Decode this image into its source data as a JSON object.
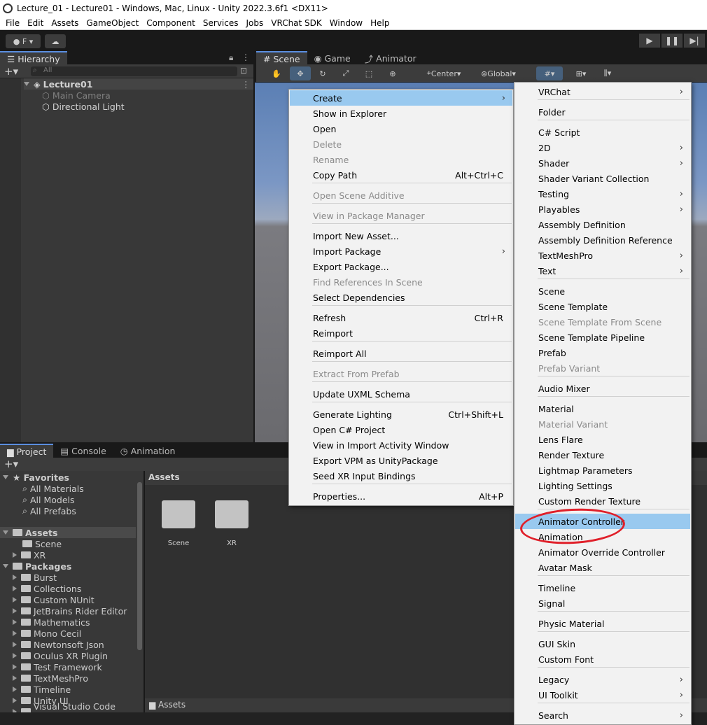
{
  "window": {
    "title": "Lecture_01 - Lecture01 - Windows, Mac, Linux - Unity 2022.3.6f1 <DX11>"
  },
  "menubar": [
    "File",
    "Edit",
    "Assets",
    "GameObject",
    "Component",
    "Services",
    "Jobs",
    "VRChat SDK",
    "Window",
    "Help"
  ],
  "toolbar": {
    "account_label": "F"
  },
  "hierarchy": {
    "tab": "Hierarchy",
    "search_placeholder": "All",
    "scene": "Lecture01",
    "items": [
      "Main Camera",
      "Directional Light"
    ]
  },
  "scene_tabs": [
    "Scene",
    "Game",
    "Animator"
  ],
  "scene_toolbar": {
    "pivot": "Center",
    "space": "Global"
  },
  "bottom_tabs": [
    "Project",
    "Console",
    "Animation"
  ],
  "project": {
    "favorites_label": "Favorites",
    "favorites": [
      "All Materials",
      "All Models",
      "All Prefabs"
    ],
    "assets_label": "Assets",
    "assets_children": [
      "Scene",
      "XR"
    ],
    "packages_label": "Packages",
    "packages": [
      "Burst",
      "Collections",
      "Custom NUnit",
      "JetBrains Rider Editor",
      "Mathematics",
      "Mono Cecil",
      "Newtonsoft Json",
      "Oculus XR Plugin",
      "Test Framework",
      "TextMeshPro",
      "Timeline",
      "Unity UI",
      "Visual Studio Code Editor"
    ],
    "breadcrumb": "Assets",
    "grid_items": [
      "Scene",
      "XR"
    ],
    "footer_path": "Assets"
  },
  "context_menu": {
    "items": [
      {
        "label": "Create",
        "shortcut": "",
        "submenu": true,
        "disabled": false,
        "highlight": true
      },
      {
        "label": "Show in Explorer",
        "shortcut": "",
        "submenu": false,
        "disabled": false
      },
      {
        "label": "Open",
        "shortcut": "",
        "submenu": false,
        "disabled": false
      },
      {
        "label": "Delete",
        "shortcut": "",
        "submenu": false,
        "disabled": true
      },
      {
        "label": "Rename",
        "shortcut": "",
        "submenu": false,
        "disabled": true
      },
      {
        "label": "Copy Path",
        "shortcut": "Alt+Ctrl+C",
        "submenu": false,
        "disabled": false
      },
      {
        "label": "Open Scene Additive",
        "shortcut": "",
        "submenu": false,
        "disabled": true
      },
      {
        "label": "View in Package Manager",
        "shortcut": "",
        "submenu": false,
        "disabled": true
      },
      {
        "label": "Import New Asset...",
        "shortcut": "",
        "submenu": false,
        "disabled": false
      },
      {
        "label": "Import Package",
        "shortcut": "",
        "submenu": true,
        "disabled": false
      },
      {
        "label": "Export Package...",
        "shortcut": "",
        "submenu": false,
        "disabled": false
      },
      {
        "label": "Find References In Scene",
        "shortcut": "",
        "submenu": false,
        "disabled": true
      },
      {
        "label": "Select Dependencies",
        "shortcut": "",
        "submenu": false,
        "disabled": false
      },
      {
        "label": "Refresh",
        "shortcut": "Ctrl+R",
        "submenu": false,
        "disabled": false
      },
      {
        "label": "Reimport",
        "shortcut": "",
        "submenu": false,
        "disabled": false
      },
      {
        "label": "Reimport All",
        "shortcut": "",
        "submenu": false,
        "disabled": false
      },
      {
        "label": "Extract From Prefab",
        "shortcut": "",
        "submenu": false,
        "disabled": true
      },
      {
        "label": "Update UXML Schema",
        "shortcut": "",
        "submenu": false,
        "disabled": false
      },
      {
        "label": "Generate Lighting",
        "shortcut": "Ctrl+Shift+L",
        "submenu": false,
        "disabled": false
      },
      {
        "label": "Open C# Project",
        "shortcut": "",
        "submenu": false,
        "disabled": false
      },
      {
        "label": "View in Import Activity Window",
        "shortcut": "",
        "submenu": false,
        "disabled": false
      },
      {
        "label": "Export VPM as UnityPackage",
        "shortcut": "",
        "submenu": false,
        "disabled": false
      },
      {
        "label": "Seed XR Input Bindings",
        "shortcut": "",
        "submenu": false,
        "disabled": false
      },
      {
        "label": "Properties...",
        "shortcut": "Alt+P",
        "submenu": false,
        "disabled": false
      }
    ]
  },
  "create_menu": {
    "items": [
      {
        "label": "VRChat",
        "submenu": true,
        "disabled": false
      },
      {
        "label": "Folder",
        "submenu": false,
        "disabled": false
      },
      {
        "label": "C# Script",
        "submenu": false,
        "disabled": false
      },
      {
        "label": "2D",
        "submenu": true,
        "disabled": false
      },
      {
        "label": "Shader",
        "submenu": true,
        "disabled": false
      },
      {
        "label": "Shader Variant Collection",
        "submenu": false,
        "disabled": false
      },
      {
        "label": "Testing",
        "submenu": true,
        "disabled": false
      },
      {
        "label": "Playables",
        "submenu": true,
        "disabled": false
      },
      {
        "label": "Assembly Definition",
        "submenu": false,
        "disabled": false
      },
      {
        "label": "Assembly Definition Reference",
        "submenu": false,
        "disabled": false
      },
      {
        "label": "TextMeshPro",
        "submenu": true,
        "disabled": false
      },
      {
        "label": "Text",
        "submenu": true,
        "disabled": false
      },
      {
        "label": "Scene",
        "submenu": false,
        "disabled": false
      },
      {
        "label": "Scene Template",
        "submenu": false,
        "disabled": false
      },
      {
        "label": "Scene Template From Scene",
        "submenu": false,
        "disabled": true
      },
      {
        "label": "Scene Template Pipeline",
        "submenu": false,
        "disabled": false
      },
      {
        "label": "Prefab",
        "submenu": false,
        "disabled": false
      },
      {
        "label": "Prefab Variant",
        "submenu": false,
        "disabled": true
      },
      {
        "label": "Audio Mixer",
        "submenu": false,
        "disabled": false
      },
      {
        "label": "Material",
        "submenu": false,
        "disabled": false
      },
      {
        "label": "Material Variant",
        "submenu": false,
        "disabled": true
      },
      {
        "label": "Lens Flare",
        "submenu": false,
        "disabled": false
      },
      {
        "label": "Render Texture",
        "submenu": false,
        "disabled": false
      },
      {
        "label": "Lightmap Parameters",
        "submenu": false,
        "disabled": false
      },
      {
        "label": "Lighting Settings",
        "submenu": false,
        "disabled": false
      },
      {
        "label": "Custom Render Texture",
        "submenu": false,
        "disabled": false
      },
      {
        "label": "Animator Controller",
        "submenu": false,
        "disabled": false,
        "highlight": true
      },
      {
        "label": "Animation",
        "submenu": false,
        "disabled": false
      },
      {
        "label": "Animator Override Controller",
        "submenu": false,
        "disabled": false
      },
      {
        "label": "Avatar Mask",
        "submenu": false,
        "disabled": false
      },
      {
        "label": "Timeline",
        "submenu": false,
        "disabled": false
      },
      {
        "label": "Signal",
        "submenu": false,
        "disabled": false
      },
      {
        "label": "Physic Material",
        "submenu": false,
        "disabled": false
      },
      {
        "label": "GUI Skin",
        "submenu": false,
        "disabled": false
      },
      {
        "label": "Custom Font",
        "submenu": false,
        "disabled": false
      },
      {
        "label": "Legacy",
        "submenu": true,
        "disabled": false
      },
      {
        "label": "UI Toolkit",
        "submenu": true,
        "disabled": false
      },
      {
        "label": "Search",
        "submenu": true,
        "disabled": false
      }
    ]
  }
}
